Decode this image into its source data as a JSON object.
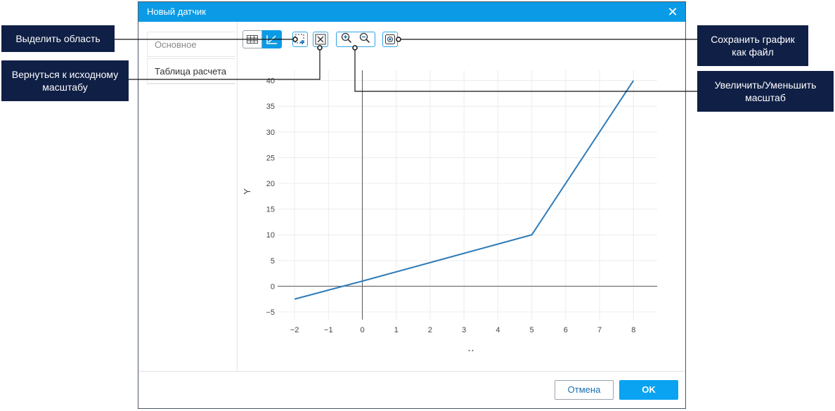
{
  "dialog": {
    "title": "Новый датчик",
    "close_icon": "close-icon"
  },
  "sidebar": {
    "tabs": [
      {
        "label": "Основное"
      },
      {
        "label": "Таблица расчета"
      }
    ]
  },
  "toolbar": {
    "icons": [
      "table-view-icon",
      "chart-view-icon",
      "select-area-icon",
      "reset-zoom-icon",
      "zoom-in-icon",
      "zoom-out-icon",
      "save-chart-icon"
    ]
  },
  "footer": {
    "cancel_label": "Отмена",
    "ok_label": "OK"
  },
  "callouts": {
    "select_area": "Выделить область",
    "reset_zoom": "Вернуться к исходному масштабу",
    "save_chart": "Сохранить график как файл",
    "zoom": "Увеличить/Уменьшить масштаб"
  },
  "colors": {
    "accent": "#0b9be6",
    "callout_bg": "#0f1f45",
    "line": "#2e7bb8"
  },
  "chart_data": {
    "type": "line",
    "xlabel": "X",
    "ylabel": "Y",
    "x": [
      -2,
      0,
      5,
      8
    ],
    "series": [
      {
        "values": [
          -2.5,
          1,
          10,
          40
        ]
      }
    ],
    "xticks": [
      -2,
      -1,
      0,
      1,
      2,
      3,
      4,
      5,
      6,
      7,
      8
    ],
    "yticks": [
      -5,
      0,
      5,
      10,
      15,
      20,
      25,
      30,
      35,
      40
    ],
    "xtick_labels": [
      "−2",
      "−1",
      "0",
      "1",
      "2",
      "3",
      "4",
      "5",
      "6",
      "7",
      "8"
    ],
    "ytick_labels": [
      "−5",
      "0",
      "5",
      "10",
      "15",
      "20",
      "25",
      "30",
      "35",
      "40"
    ],
    "xlim": [
      -2.5,
      8.7
    ],
    "ylim": [
      -6.5,
      42
    ],
    "grid": true
  }
}
